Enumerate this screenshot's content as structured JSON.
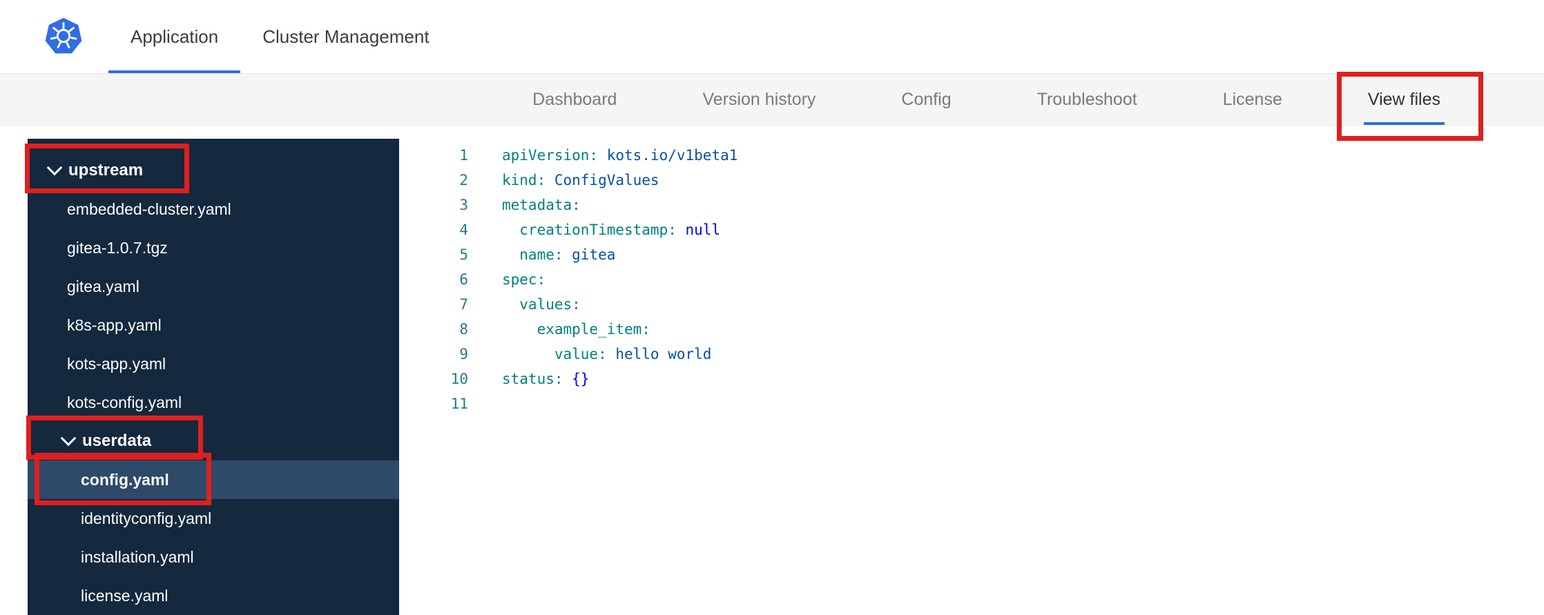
{
  "header": {
    "tabs": [
      {
        "label": "Application",
        "active": true
      },
      {
        "label": "Cluster Management",
        "active": false
      }
    ]
  },
  "subnav": {
    "items": [
      {
        "label": "Dashboard",
        "active": false
      },
      {
        "label": "Version history",
        "active": false
      },
      {
        "label": "Config",
        "active": false
      },
      {
        "label": "Troubleshoot",
        "active": false
      },
      {
        "label": "License",
        "active": false
      },
      {
        "label": "View files",
        "active": true,
        "annotated": true
      }
    ]
  },
  "file_tree": {
    "items": [
      {
        "label": "upstream",
        "type": "folder",
        "level": 0,
        "expanded": true,
        "annotated": true
      },
      {
        "label": "embedded-cluster.yaml",
        "type": "file",
        "level": 1
      },
      {
        "label": "gitea-1.0.7.tgz",
        "type": "file",
        "level": 1
      },
      {
        "label": "gitea.yaml",
        "type": "file",
        "level": 1
      },
      {
        "label": "k8s-app.yaml",
        "type": "file",
        "level": 1
      },
      {
        "label": "kots-app.yaml",
        "type": "file",
        "level": 1
      },
      {
        "label": "kots-config.yaml",
        "type": "file",
        "level": 1
      },
      {
        "label": "userdata",
        "type": "folder",
        "level": 1,
        "expanded": true,
        "annotated": true
      },
      {
        "label": "config.yaml",
        "type": "file",
        "level": 2,
        "selected": true,
        "annotated": true
      },
      {
        "label": "identityconfig.yaml",
        "type": "file",
        "level": 2
      },
      {
        "label": "installation.yaml",
        "type": "file",
        "level": 2
      },
      {
        "label": "license.yaml",
        "type": "file",
        "level": 2
      }
    ]
  },
  "editor": {
    "lines": [
      {
        "num": 1,
        "tokens": [
          {
            "type": "key",
            "text": "apiVersion:"
          },
          {
            "type": "val",
            "text": " kots.io/v1beta1"
          }
        ]
      },
      {
        "num": 2,
        "tokens": [
          {
            "type": "key",
            "text": "kind:"
          },
          {
            "type": "val",
            "text": " ConfigValues"
          }
        ]
      },
      {
        "num": 3,
        "tokens": [
          {
            "type": "key",
            "text": "metadata:"
          }
        ]
      },
      {
        "num": 4,
        "tokens": [
          {
            "type": "key",
            "text": "  creationTimestamp:"
          },
          {
            "type": "kw",
            "text": " null"
          }
        ]
      },
      {
        "num": 5,
        "tokens": [
          {
            "type": "key",
            "text": "  name:"
          },
          {
            "type": "val",
            "text": " gitea"
          }
        ]
      },
      {
        "num": 6,
        "tokens": [
          {
            "type": "key",
            "text": "spec:"
          }
        ]
      },
      {
        "num": 7,
        "tokens": [
          {
            "type": "key",
            "text": "  values:"
          }
        ]
      },
      {
        "num": 8,
        "tokens": [
          {
            "type": "key",
            "text": "    example_item:"
          }
        ]
      },
      {
        "num": 9,
        "tokens": [
          {
            "type": "key",
            "text": "      value:"
          },
          {
            "type": "val",
            "text": " hello world"
          }
        ]
      },
      {
        "num": 10,
        "tokens": [
          {
            "type": "key",
            "text": "status:"
          },
          {
            "type": "kw",
            "text": " {}"
          }
        ]
      },
      {
        "num": 11,
        "tokens": []
      }
    ]
  },
  "colors": {
    "accent_blue": "#2f6ddb",
    "annotation_red": "#e01f1f",
    "sidebar_bg": "#14283e",
    "sidebar_selected_bg": "#2d4a68",
    "yaml_key": "#008080",
    "yaml_value": "#0451a5",
    "yaml_keyword": "#0000ff"
  }
}
